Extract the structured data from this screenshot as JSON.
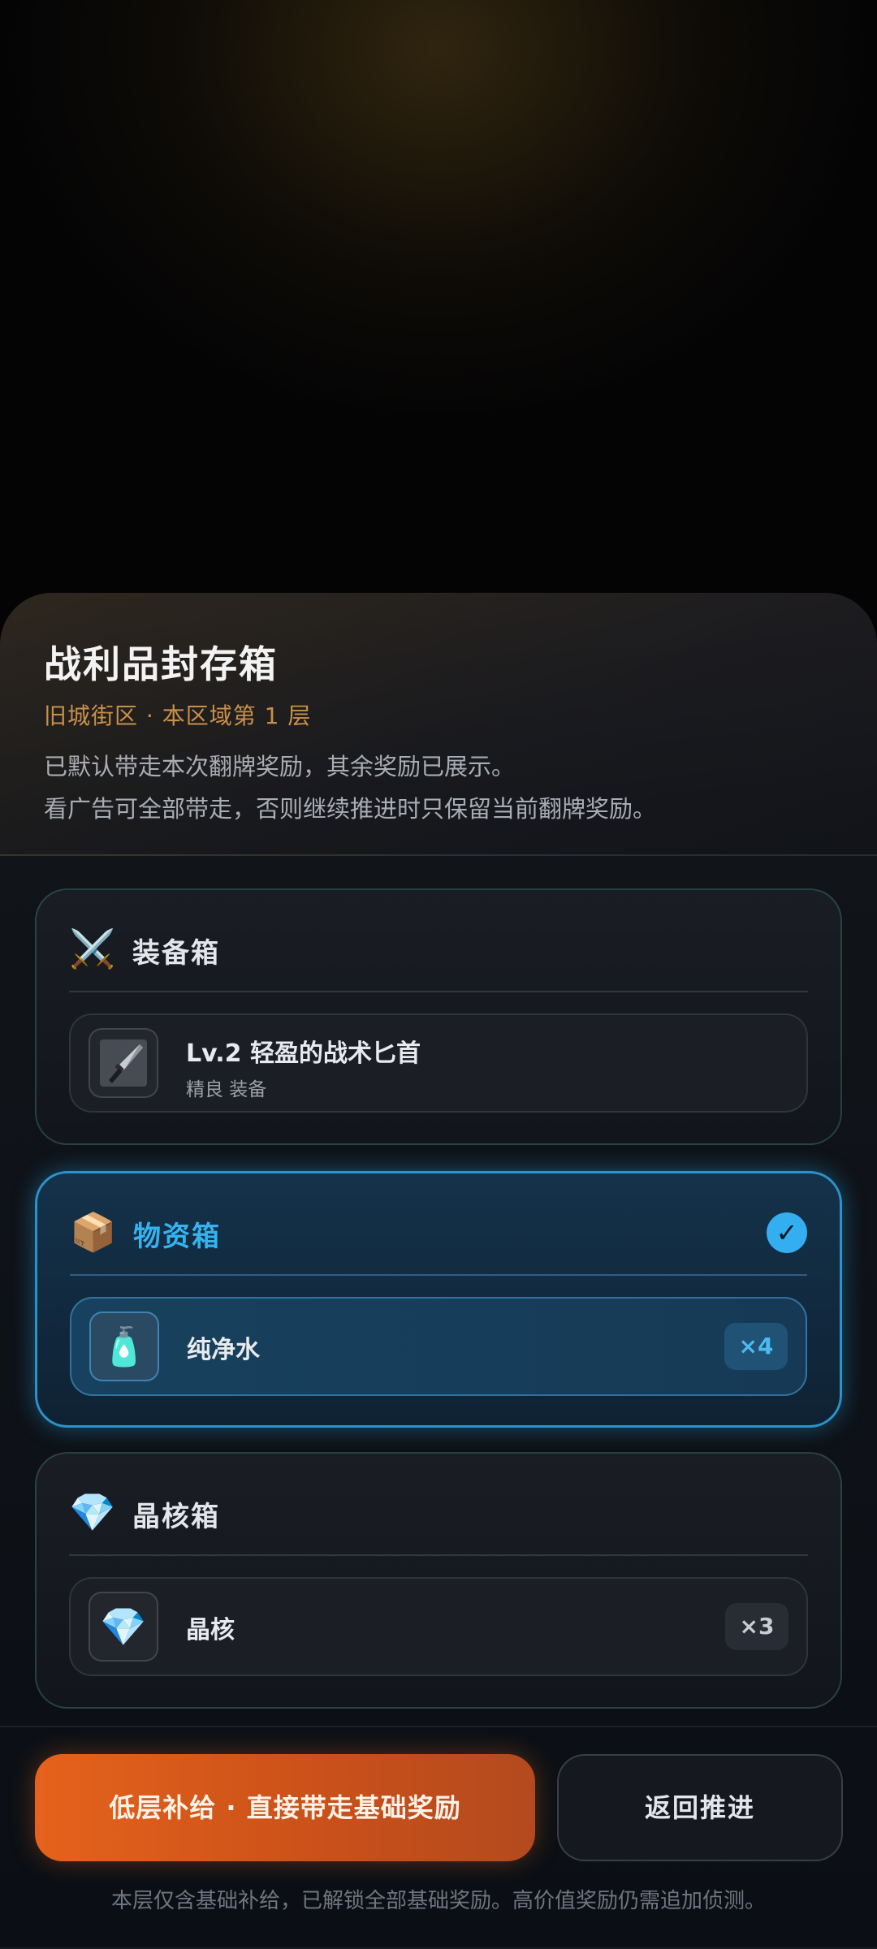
{
  "header": {
    "title": "战利品封存箱",
    "subtitle": "旧城街区 · 本区域第 1 层",
    "description_lines": [
      "已默认带走本次翻牌奖励，其余奖励已展示。",
      "看广告可全部带走，否则继续推进时只保留当前翻牌奖励。"
    ]
  },
  "boxes": [
    {
      "icon": "crossed-swords-icon",
      "icon_glyph": "⚔️",
      "title": "装备箱",
      "selected": false,
      "item": {
        "icon": "knife-icon",
        "name": "Lv.2 轻盈的战术匕首",
        "meta": "精良 装备"
      }
    },
    {
      "icon": "package-icon",
      "icon_glyph": "📦",
      "title": "物资箱",
      "selected": true,
      "check_glyph": "✓",
      "item": {
        "icon": "water-bottle-icon",
        "icon_glyph": "🧴",
        "name": "纯净水",
        "qty": "×4"
      }
    },
    {
      "icon": "gem-icon",
      "icon_glyph": "💎",
      "title": "晶核箱",
      "selected": false,
      "item": {
        "icon": "gem-icon",
        "icon_glyph": "💎",
        "name": "晶核",
        "qty": "×3"
      }
    }
  ],
  "actions": {
    "primary_label": "低层补给 · 直接带走基础奖励",
    "secondary_label": "返回推进"
  },
  "footnote": "本层仅含基础补给，已解锁全部基础奖励。高价值奖励仍需追加侦测。",
  "colors": {
    "accent_orange": "#e5621b",
    "accent_blue": "#33aef0",
    "subtitle_gold": "#c9904a"
  }
}
